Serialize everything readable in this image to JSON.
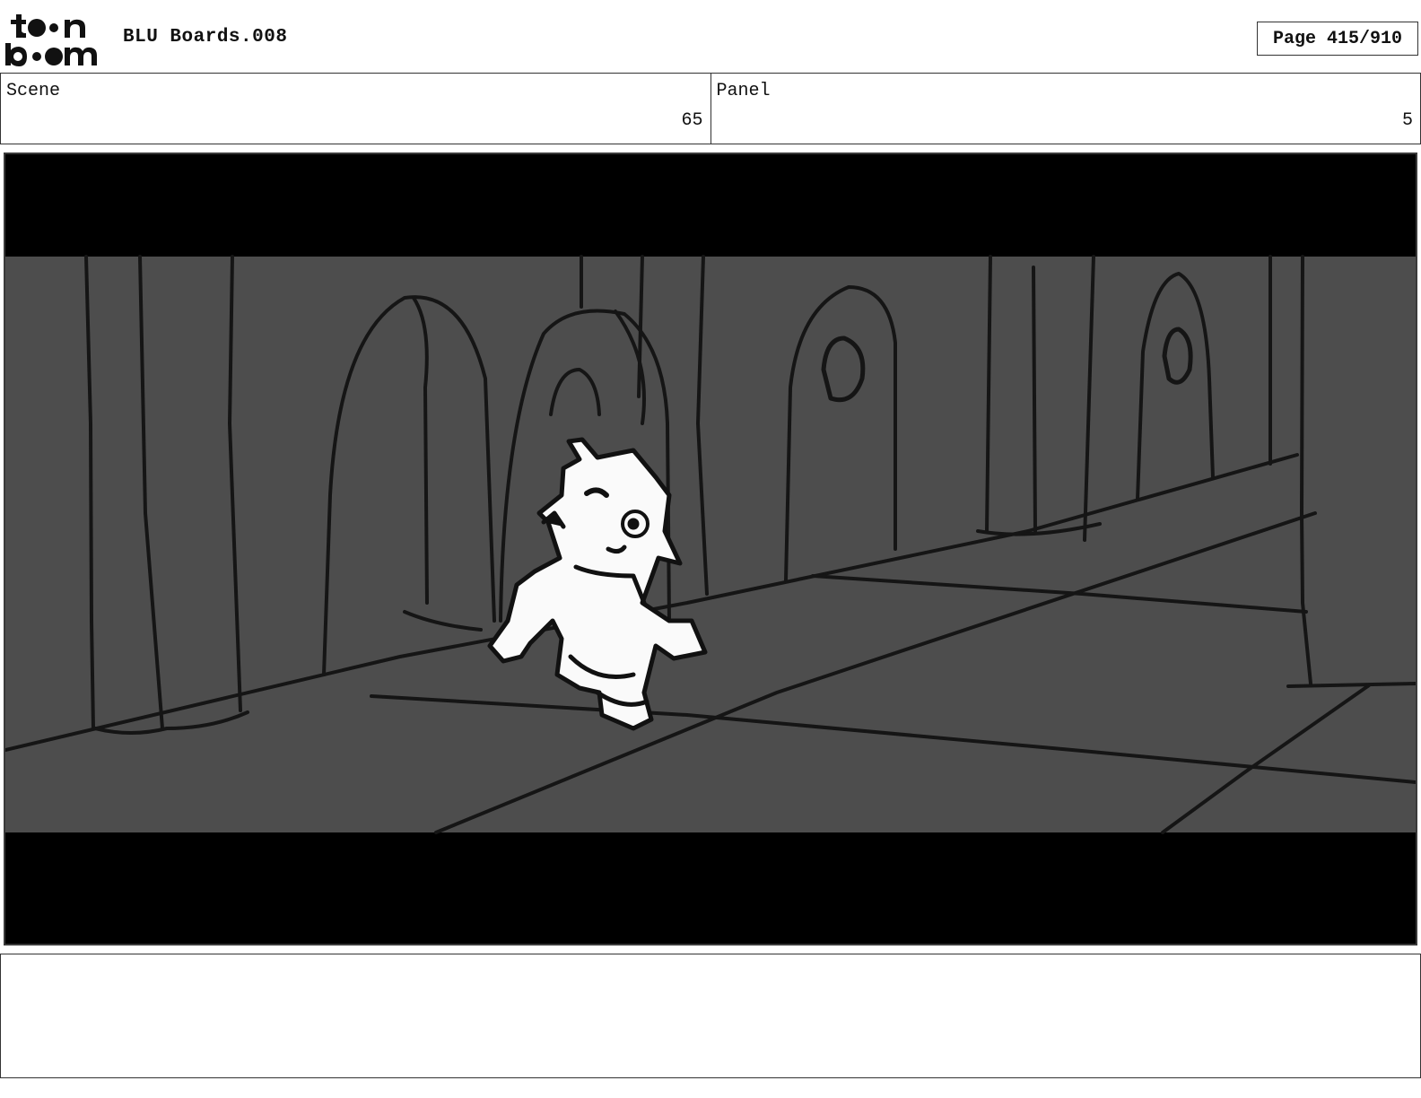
{
  "header": {
    "logo_alt": "toon boom",
    "doc_title": "BLU Boards.008",
    "page": "Page 415/910"
  },
  "scene": {
    "label": "Scene",
    "value": "65"
  },
  "panel": {
    "label": "Panel",
    "value": "5"
  },
  "colors": {
    "frame_bg": "#4d4d4d",
    "letterbox": "#000000",
    "ink": "#111111"
  }
}
